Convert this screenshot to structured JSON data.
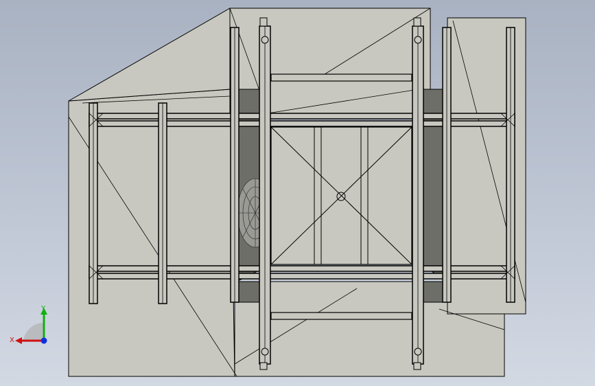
{
  "view": {
    "triad": {
      "x_label": "X",
      "y_label": "Y"
    }
  },
  "colors": {
    "background_top": "#a9b2c2",
    "background_bottom": "#d3d9e3",
    "plate": "#c8c8c0",
    "shadow": "#6e6e68",
    "edge": "#000000",
    "x_axis": "#d01010",
    "y_axis": "#10b010",
    "z_axis": "#1030e0"
  }
}
